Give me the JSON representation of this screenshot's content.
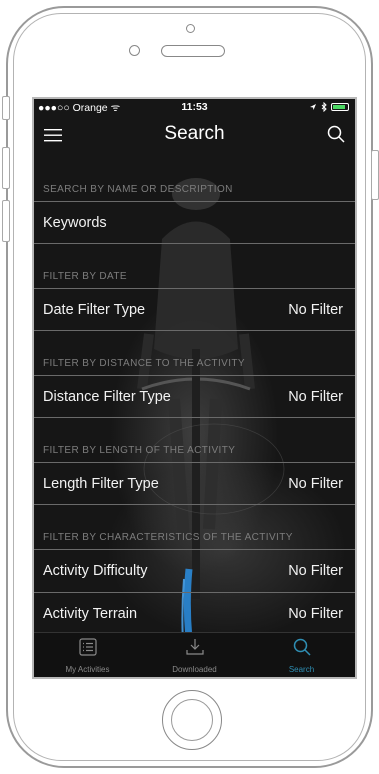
{
  "status_bar": {
    "carrier": "●●●○○ Orange ᯤ",
    "time": "11:53",
    "battery_level": 0.85
  },
  "nav": {
    "title": "Search"
  },
  "sections": [
    {
      "header": "SEARCH BY NAME OR DESCRIPTION",
      "rows": [
        {
          "label": "Keywords",
          "value": ""
        }
      ]
    },
    {
      "header": "FILTER BY DATE",
      "rows": [
        {
          "label": "Date Filter Type",
          "value": "No Filter"
        }
      ]
    },
    {
      "header": "FILTER BY DISTANCE TO THE ACTIVITY",
      "rows": [
        {
          "label": "Distance Filter Type",
          "value": "No Filter"
        }
      ]
    },
    {
      "header": "FILTER BY LENGTH OF THE ACTIVITY",
      "rows": [
        {
          "label": "Length Filter Type",
          "value": "No Filter"
        }
      ]
    },
    {
      "header": "FILTER BY CHARACTERISTICS OF THE ACTIVITY",
      "rows": [
        {
          "label": "Activity Difficulty",
          "value": "No Filter"
        },
        {
          "label": "Activity Terrain",
          "value": "No Filter"
        }
      ]
    }
  ],
  "tabs": [
    {
      "label": "My Activities",
      "icon": "list-icon",
      "active": false
    },
    {
      "label": "Downloaded",
      "icon": "download-icon",
      "active": false
    },
    {
      "label": "Search",
      "icon": "search-icon",
      "active": true
    }
  ],
  "colors": {
    "accent": "#2f8fb4",
    "background": "#161616",
    "separator": "#6a6a6a"
  }
}
